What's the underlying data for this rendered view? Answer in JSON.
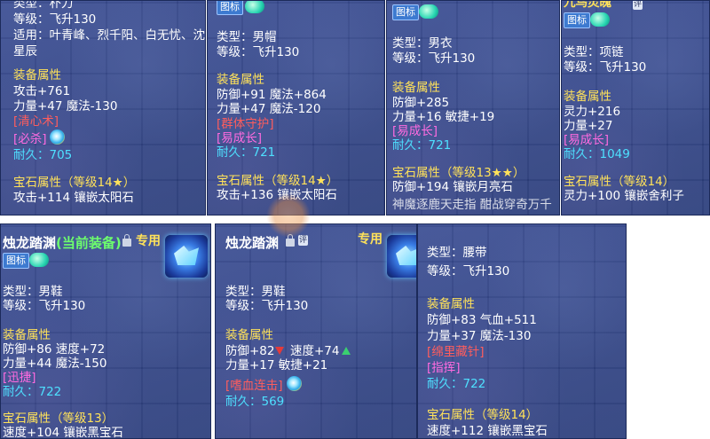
{
  "panel1": {
    "type": "类型：朴刀",
    "level": "等级：飞升130",
    "applicable": "适用：叶青峰、烈千阳、白无忧、沈",
    "applicable_cont": "星辰",
    "attr_header": "装备属性",
    "attr1": "攻击+761",
    "attr2": "力量+47 魔法-130",
    "skill": "[清心术]",
    "special": "[必杀]",
    "durability": "耐久：705",
    "gem_header": "宝石属性（等级14★）",
    "gem_attr": "攻击+114 镶嵌太阳石"
  },
  "panel2": {
    "badge": "图标",
    "type": "类型：男帽",
    "level": "等级：飞升130",
    "attr_header": "装备属性",
    "attr1": "防御+91 魔法+864",
    "attr2": "力量+47 魔法-120",
    "skill": "[群体守护]",
    "special": "[易成长]",
    "durability": "耐久：721",
    "gem_header": "宝石属性（等级14★）",
    "gem_attr": "攻击+136 镶嵌太阳石"
  },
  "panel3": {
    "badge": "图标",
    "type": "类型：男衣",
    "level": "等级：飞升130",
    "attr_header": "装备属性",
    "attr1": "防御+285",
    "attr2": "力量+16 敏捷+19",
    "special": "[易成长]",
    "durability": "耐久：721",
    "gem_header": "宝石属性（等级13★★）",
    "gem_attr": "防御+194 镶嵌月亮石",
    "cut_text": "神魔逐鹿天走指 酣战穿奇万千"
  },
  "panel4": {
    "title": "九鸟灵魄",
    "ping": "评",
    "badge": "图标",
    "type": "类型：项链",
    "level": "等级：飞升130",
    "attr_header": "装备属性",
    "attr1": "灵力+216",
    "attr2": "力量+27",
    "special": "[易成长]",
    "durability": "耐久：1049",
    "gem_header": "宝石属性（等级14）",
    "gem_attr": "灵力+100 镶嵌舍利子"
  },
  "panel5": {
    "title": "烛龙踏渊",
    "equipped": "(当前装备)",
    "spec": "专用",
    "badge": "图标",
    "type": "类型：男鞋",
    "level": "等级：飞升130",
    "attr_header": "装备属性",
    "attr1": "防御+86 速度+72",
    "attr2": "力量+44 魔法-150",
    "special": "[迅捷]",
    "durability": "耐久：722",
    "gem_header": "宝石属性（等级13）",
    "gem_attr": "速度+104 镶嵌黑宝石"
  },
  "panel6": {
    "title": "烛龙踏渊",
    "ping": "评",
    "spec": "专用",
    "type": "类型：男鞋",
    "level": "等级：飞升130",
    "attr_header": "装备属性",
    "attr1a": "防御+82",
    "attr1b": "速度+74",
    "attr2": "力量+17 敏捷+21",
    "skill": "[嗜血连击]",
    "durability": "耐久：569"
  },
  "panel7": {
    "type": "类型：腰带",
    "level": "等级：飞升130",
    "attr_header": "装备属性",
    "attr1": "防御+83 气血+511",
    "attr2": "力量+37 魔法-130",
    "skill": "[绵里藏针]",
    "special": "[指挥]",
    "durability": "耐久：722",
    "gem_header": "宝石属性（等级14）",
    "gem_attr": "速度+112 镶嵌黑宝石"
  },
  "colors": {
    "panel_bg": "#334688",
    "white_text": "#ffffff",
    "header_yellow": "#ffe25a",
    "skill_red": "#ff5d5d",
    "special_magenta": "#ff6be0",
    "durability_cyan": "#4ee0ff",
    "equipped_green": "#6dff6d"
  },
  "icons": [
    "toggle-icon",
    "lock-icon",
    "swirl-icon",
    "shoe-icon",
    "arrow-down-icon",
    "arrow-up-icon"
  ]
}
